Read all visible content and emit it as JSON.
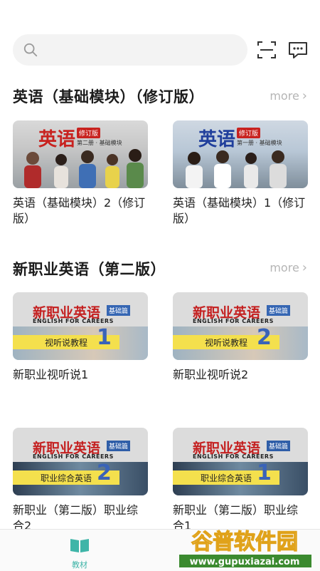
{
  "search": {
    "placeholder": "",
    "value": ""
  },
  "sections": [
    {
      "title": "英语（基础模块）（修订版）",
      "more_label": "more",
      "items": [
        {
          "title": "英语（基础模块）2（修订版）",
          "cover": {
            "main": "英语",
            "tag": "修订版",
            "sub": "第二册 · 基础模块"
          }
        },
        {
          "title": "英语（基础模块）1（修订版）",
          "cover": {
            "main": "英语",
            "tag": "修订版",
            "sub": "第一册 · 基础模块"
          }
        }
      ]
    },
    {
      "title": "新职业英语（第二版）",
      "more_label": "more",
      "items": [
        {
          "title": "新职业视听说1",
          "cover": {
            "series": "新职业英语",
            "kind": "基础篇",
            "english": "ENGLISH FOR CAREERS",
            "band": "视听说教程",
            "num": "1"
          }
        },
        {
          "title": "新职业视听说2",
          "cover": {
            "series": "新职业英语",
            "kind": "基础篇",
            "english": "ENGLISH FOR CAREERS",
            "band": "视听说教程",
            "num": "2"
          }
        },
        {
          "title": "新职业（第二版）职业综合2",
          "cover": {
            "series": "新职业英语",
            "kind": "基础篇",
            "english": "ENGLISH FOR CAREERS",
            "band": "职业综合英语",
            "num": "2"
          }
        },
        {
          "title": "新职业（第二版）职业综合1",
          "cover": {
            "series": "新职业英语",
            "kind": "基础篇",
            "english": "ENGLISH FOR CAREERS",
            "band": "职业综合英语",
            "num": "1"
          }
        }
      ]
    }
  ],
  "tabbar": {
    "tabs": [
      {
        "label": "教材",
        "active": true,
        "icon": "book-icon"
      }
    ]
  },
  "watermark": {
    "line1": "谷普软件园",
    "line2": "www.gupuxiazai.com"
  },
  "colors": {
    "accent": "#3fb5a8",
    "more": "#b5b5b5",
    "search_bg": "#f3f3f3"
  }
}
